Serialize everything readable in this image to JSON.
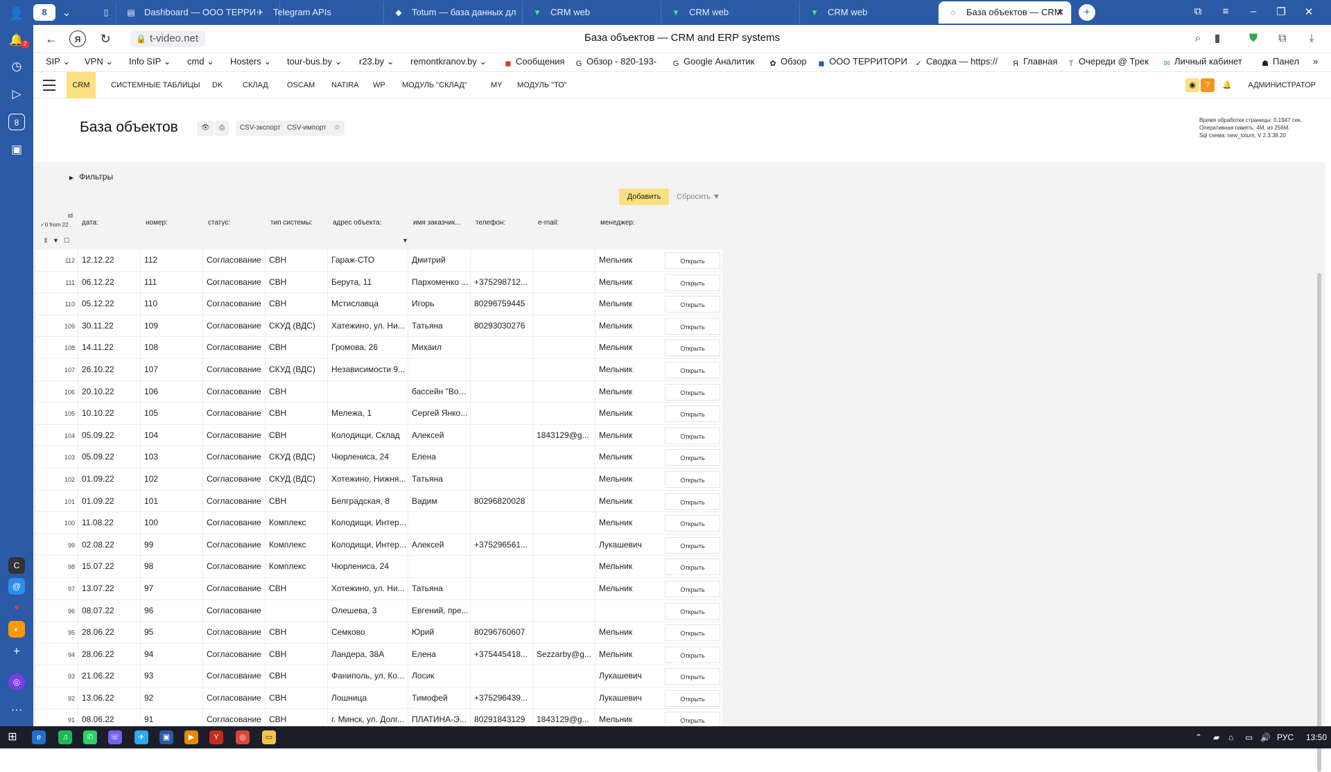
{
  "browser": {
    "tab_count": "8",
    "tabs": [
      {
        "title": "Dashboard — ООО ТЕРРИ",
        "icon": "dashboard-icon"
      },
      {
        "title": "Telegram APIs",
        "icon": "telegram-icon"
      },
      {
        "title": "Totum — база данных дл",
        "icon": "totum-icon"
      },
      {
        "title": "CRM web",
        "icon": "crm-icon"
      },
      {
        "title": "CRM web",
        "icon": "crm-icon"
      },
      {
        "title": "CRM web",
        "icon": "crm-icon"
      },
      {
        "title": "База объектов — CRM",
        "icon": "page-icon"
      }
    ],
    "url": "t-video.net",
    "page_title": "База объектов — CRM and ERP systems",
    "notification_count": "2",
    "sidebar_app_8": "8",
    "sidebar_app_c": "C"
  },
  "bookmarks": [
    "SIP",
    "VPN",
    "Info SIP",
    "cmd",
    "Hosters",
    "tour-bus.by",
    "r23.by",
    "remontkranov.by",
    "Сообщения",
    "Обзор - 820-193-",
    "Google Аналитик",
    "Обзор",
    "ООО ТЕРРИТОРИ",
    "Сводка — https://",
    "Главная",
    "Очереди @ Трек",
    "Личный кабинет",
    "Панел"
  ],
  "appmenu": {
    "items": [
      "CRM",
      "СИСТЕМНЫЕ ТАБЛИЦЫ",
      "DK",
      "СКЛАД",
      "OSCAM",
      "NATIRA",
      "WP",
      "МОДУЛЬ \"СКЛАД\"",
      "MY",
      "МОДУЛЬ \"ТО\""
    ],
    "admin_label": "АДМИНИСТРАТОР",
    "help_label": "?"
  },
  "page": {
    "title": "База объектов",
    "csv_export": "CSV-экспорт",
    "csv_import": "CSV-импорт",
    "star": "☆",
    "info_lines": [
      "Время обработки страницы: 0.1947 сек.",
      "Оперативная память: 4М. из 256М.",
      "Sql схема: new_totum, V 2.3.38.20"
    ]
  },
  "content": {
    "filters_label": "Фильтры",
    "add_label": "Добавить",
    "reset_label": "Сбросить"
  },
  "table": {
    "selection_label": "✓0 from 22",
    "id_header": "id",
    "headers": [
      "дата:",
      "номер:",
      "статус:",
      "тип системы:",
      "адрес объекта:",
      "имя заказчик...",
      "телефон:",
      "e-mail:",
      "менеджер:"
    ],
    "open_label": "Открыть",
    "rows": [
      [
        "112",
        "12.12.22",
        "112",
        "Согласование",
        "СВН",
        "Гараж-СТО",
        "Дмитрий",
        "",
        "",
        "Мельник"
      ],
      [
        "111",
        "06.12.22",
        "111",
        "Согласование",
        "СВН",
        "Берута, 11",
        "Пархоменко ...",
        "+375298712...",
        "",
        "Мельник"
      ],
      [
        "110",
        "05.12.22",
        "110",
        "Согласование",
        "СВН",
        "Мстиславца",
        "Игорь",
        "80296759445",
        "",
        "Мельник"
      ],
      [
        "109",
        "30.11.22",
        "109",
        "Согласование",
        "СКУД (ВДС)",
        "Хатежино, ул. Ни...",
        "Татьяна",
        "80293030276",
        "",
        "Мельник"
      ],
      [
        "108",
        "14.11.22",
        "108",
        "Согласование",
        "СВН",
        "Громова, 26",
        "Михаил",
        "",
        "",
        "Мельник"
      ],
      [
        "107",
        "26.10.22",
        "107",
        "Согласование",
        "СКУД (ВДС)",
        "Независимости 9...",
        "",
        "",
        "",
        "Мельник"
      ],
      [
        "106",
        "20.10.22",
        "106",
        "Согласование",
        "СВН",
        "",
        "бассейн \"Вол...",
        "",
        "",
        "Мельник"
      ],
      [
        "105",
        "10.10.22",
        "105",
        "Согласование",
        "СВН",
        "Мележа, 1",
        "Сергей Янко...",
        "",
        "",
        "Мельник"
      ],
      [
        "104",
        "05.09.22",
        "104",
        "Согласование",
        "СВН",
        "Колодищи, Склад",
        "Алексей",
        "",
        "1843129@g...",
        "Мельник"
      ],
      [
        "103",
        "05.09.22",
        "103",
        "Согласование",
        "СКУД (ВДС)",
        "Чюрлениса, 24",
        "Елена",
        "",
        "",
        "Мельник"
      ],
      [
        "102",
        "01.09.22",
        "102",
        "Согласование",
        "СКУД (ВДС)",
        "Хотежино, Нижня...",
        "Татьяна",
        "",
        "",
        "Мельник"
      ],
      [
        "101",
        "01.09.22",
        "101",
        "Согласование",
        "СВН",
        "Белградская, 8",
        "Вадим",
        "80296820028",
        "",
        "Мельник"
      ],
      [
        "100",
        "11.08.22",
        "100",
        "Согласование",
        "Комплекс",
        "Колодищи, Интер...",
        "",
        "",
        "",
        "Мельник"
      ],
      [
        "99",
        "02.08.22",
        "99",
        "Согласование",
        "Комплекс",
        "Колодищи, Интер...",
        "Алексей",
        "+375296561...",
        "",
        "Лукашевич"
      ],
      [
        "98",
        "15.07.22",
        "98",
        "Согласование",
        "Комплекс",
        "Чюрлениса, 24",
        "",
        "",
        "",
        "Мельник"
      ],
      [
        "97",
        "13.07.22",
        "97",
        "Согласование",
        "СВН",
        "Хотежино, ул. Ни...",
        "Татьяна",
        "",
        "",
        "Мельник"
      ],
      [
        "96",
        "08.07.22",
        "96",
        "Согласование",
        "",
        "Олешева, 3",
        "Евгений, пре...",
        "",
        "",
        ""
      ],
      [
        "95",
        "28.06.22",
        "95",
        "Согласование",
        "СВН",
        "Семково",
        "Юрий",
        "80296760607",
        "",
        "Мельник"
      ],
      [
        "94",
        "28.06.22",
        "94",
        "Согласование",
        "СВН",
        "Ландера, 38А",
        "Елена",
        "+375445418...",
        "Sezzarby@g...",
        "Мельник"
      ],
      [
        "93",
        "21.06.22",
        "93",
        "Согласование",
        "СВН",
        "Фаниполь, ул. Ко...",
        "Лосик",
        "",
        "",
        "Лукашевич"
      ],
      [
        "92",
        "13.06.22",
        "92",
        "Согласование",
        "СВН",
        "Лошница",
        "Тимофей",
        "+375296439...",
        "",
        "Лукашевич"
      ],
      [
        "91",
        "08.06.22",
        "91",
        "Согласование",
        "СВН",
        "г. Минск, ул. Долг...",
        "ПЛАТИНА-Э...",
        "80291843129",
        "1843129@g...",
        "Мельник"
      ]
    ]
  },
  "taskbar": {
    "lang": "РУС",
    "time": "13:50"
  },
  "colors": {
    "browser_blue": "#2b5aa6",
    "accent_yellow": "#fbe07f",
    "taskbar": "#1b1e28"
  }
}
